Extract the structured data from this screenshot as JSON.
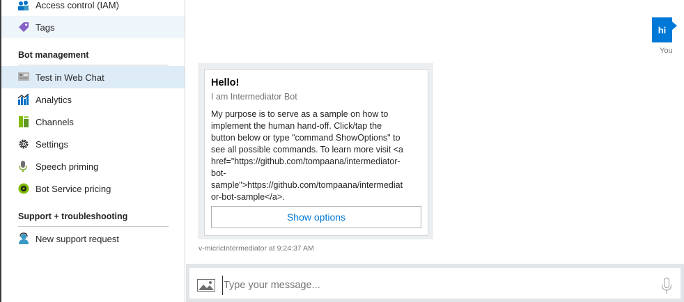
{
  "sidebar": {
    "items_top": [
      {
        "label": "Access control (IAM)",
        "icon": "access-control-icon"
      },
      {
        "label": "Tags",
        "icon": "tag-icon"
      }
    ],
    "bot_management": {
      "header": "Bot management",
      "items": [
        {
          "label": "Test in Web Chat",
          "icon": "web-chat-icon"
        },
        {
          "label": "Analytics",
          "icon": "analytics-icon"
        },
        {
          "label": "Channels",
          "icon": "channels-icon"
        },
        {
          "label": "Settings",
          "icon": "gear-icon"
        },
        {
          "label": "Speech priming",
          "icon": "speech-icon"
        },
        {
          "label": "Bot Service pricing",
          "icon": "pricing-icon"
        }
      ]
    },
    "support": {
      "header": "Support + troubleshooting",
      "items": [
        {
          "label": "New support request",
          "icon": "support-person-icon"
        }
      ]
    }
  },
  "chat": {
    "user_message": {
      "text": "hi",
      "sender": "You"
    },
    "bot_card": {
      "title": "Hello!",
      "subtitle": "I am Intermediator Bot",
      "text_lines": [
        "My purpose is to serve as a sample on how to",
        "implement the human hand-off. Click/tap the",
        "button below or type \"command ShowOptions\" to",
        "see all possible commands. To learn more visit <a",
        "href=\"https://github.com/tompaana/intermediator-",
        "bot-",
        "sample\">https://github.com/tompaana/intermediat",
        "or-bot-sample</a>."
      ],
      "button_label": "Show options"
    },
    "bot_timestamp": "v-micricIntermediator at 9:24:37 AM",
    "input": {
      "placeholder": "Type your message...",
      "value": ""
    }
  },
  "colors": {
    "accent": "#0078d7",
    "selected_bg": "#ddecf7",
    "card_frame": "#eceff1"
  }
}
